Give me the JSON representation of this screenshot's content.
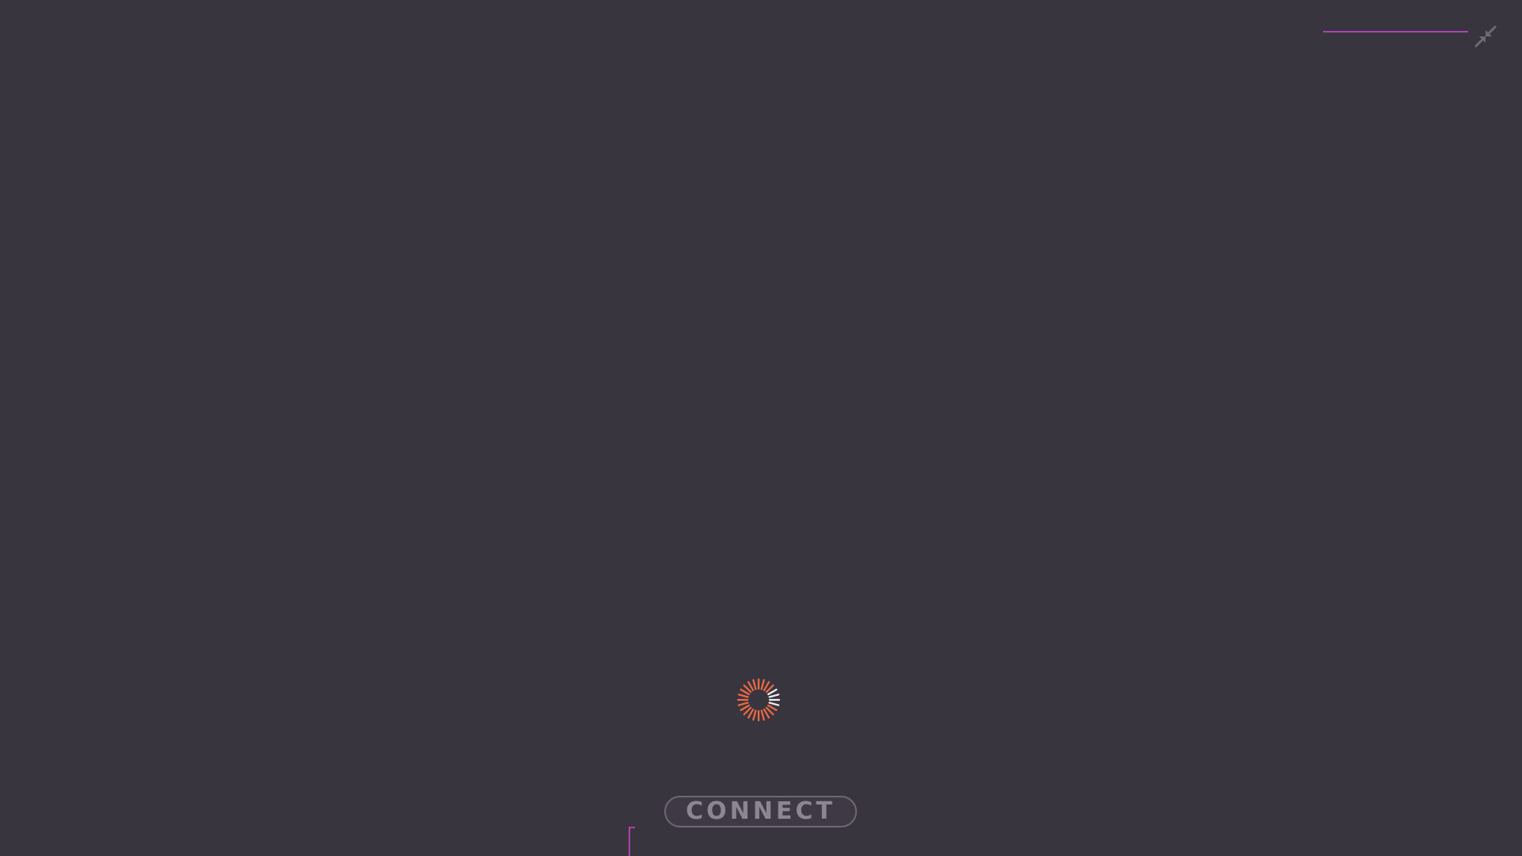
{
  "screen": {
    "background_color": "#39353f",
    "accent_color": "#b43fb0"
  },
  "top_bar": {
    "collapse_icon": "collapse-arrows-icon",
    "icon_color": "#6e6a74"
  },
  "loading": {
    "icon": "loading-spinner-icon",
    "spinner_color": "#ef6a45",
    "spinner_highlight_color": "#f2eef2"
  },
  "connect": {
    "label": "CONNECT",
    "text_color": "#8b8690",
    "border_color": "#6e6875"
  }
}
